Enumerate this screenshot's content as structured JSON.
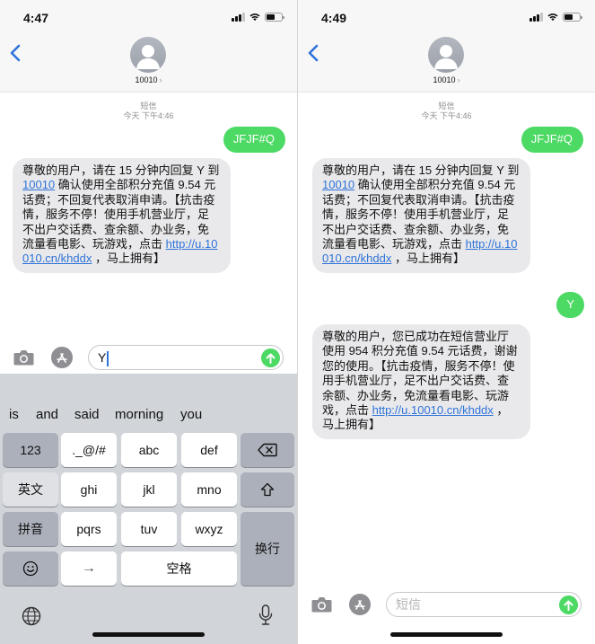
{
  "left": {
    "status": {
      "time": "4:47"
    },
    "contact": {
      "name": "10010"
    },
    "thread": {
      "service_label": "短信",
      "timestamp": "今天 下午4:46",
      "messages": [
        {
          "type": "out",
          "text": "JFJF#Q"
        },
        {
          "type": "in",
          "text_before": "尊敬的用户，请在 15 分钟内回复 Y 到 ",
          "link1": "10010",
          "text_mid": " 确认使用全部积分充值 9.54 元话费；不回复代表取消申请。【抗击疫情，服务不停！使用手机营业厅，足不出户交话费、查余额、办业务，免流量看电影、玩游戏，点击 ",
          "link2": "http://u.10010.cn/khddx",
          "text_after": " ，马上拥有】"
        }
      ]
    },
    "composer": {
      "value": "Y"
    },
    "keyboard": {
      "suggestions": [
        "is",
        "and",
        "said",
        "morning",
        "you"
      ],
      "row1": [
        "123",
        "._@/#",
        "abc",
        "def"
      ],
      "row2": [
        "英文",
        "ghi",
        "jkl",
        "mno"
      ],
      "row3": [
        "拼音",
        "pqrs",
        "tuv",
        "wxyz"
      ],
      "row4_arrow": "→",
      "row4_space": "空格",
      "enter": "换行",
      "icons": {
        "backspace": "backspace-icon",
        "shift": "shift-icon",
        "emoji": "emoji-icon",
        "globe": "globe-icon",
        "mic": "microphone-icon"
      }
    }
  },
  "right": {
    "status": {
      "time": "4:49"
    },
    "contact": {
      "name": "10010"
    },
    "thread": {
      "service_label": "短信",
      "timestamp": "今天 下午4:46",
      "messages": [
        {
          "type": "out",
          "text": "JFJF#Q"
        },
        {
          "type": "in",
          "text_before": "尊敬的用户，请在 15 分钟内回复 Y 到 ",
          "link1": "10010",
          "text_mid": " 确认使用全部积分充值 9.54 元话费；不回复代表取消申请。【抗击疫情，服务不停！使用手机营业厅，足不出户交话费、查余额、办业务，免流量看电影、玩游戏，点击 ",
          "link2": "http://u.10010.cn/khddx",
          "text_after": " ，马上拥有】"
        },
        {
          "type": "out",
          "text": "Y"
        },
        {
          "type": "in",
          "text_before": "尊敬的用户，您已成功在短信营业厅使用 954 积分充值 9.54 元话费，谢谢您的使用。【抗击疫情，服务不停！使用手机营业厅，足不出户交话费、查余额、办业务，免流量看电影、玩游戏，点击 ",
          "link2": "http://u.10010.cn/khddx",
          "text_after": " ，马上拥有】"
        }
      ]
    },
    "composer": {
      "placeholder": "短信"
    }
  },
  "colors": {
    "outgoing_bubble": "#4cd964",
    "incoming_bubble": "#e9e9eb",
    "link": "#2f73d9",
    "ios_blue": "#2f73d9"
  }
}
